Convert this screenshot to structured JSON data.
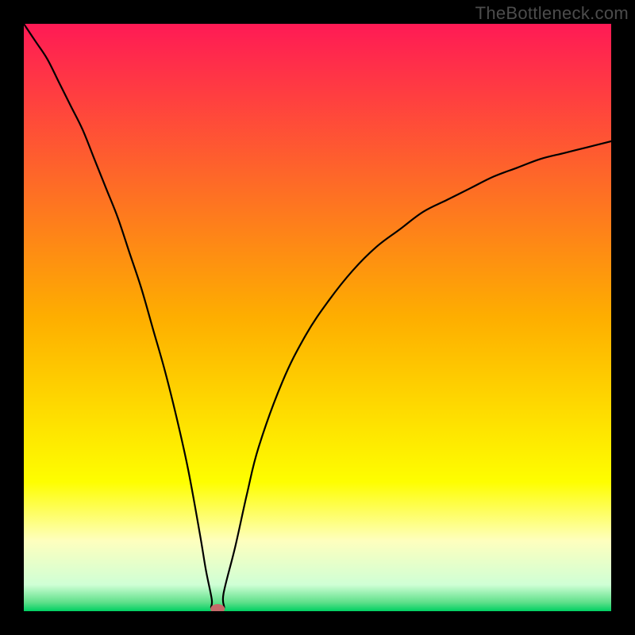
{
  "watermark": "TheBottleneck.com",
  "chart_data": {
    "type": "line",
    "title": "",
    "xlabel": "",
    "ylabel": "",
    "xlim": [
      0,
      100
    ],
    "ylim": [
      0,
      100
    ],
    "curve_min_x": 33,
    "marker": {
      "x": 33,
      "y": 0,
      "color": "#c56a6a"
    },
    "background_gradient": [
      {
        "offset": 0.0,
        "color": "#ff1a55"
      },
      {
        "offset": 0.5,
        "color": "#feae00"
      },
      {
        "offset": 0.78,
        "color": "#fefe00"
      },
      {
        "offset": 0.88,
        "color": "#feffbe"
      },
      {
        "offset": 0.955,
        "color": "#cfffd5"
      },
      {
        "offset": 0.985,
        "color": "#5fe08a"
      },
      {
        "offset": 1.0,
        "color": "#00d062"
      }
    ],
    "series": [
      {
        "name": "bottleneck-curve",
        "x": [
          0,
          2,
          4,
          6,
          8,
          10,
          12,
          14,
          16,
          18,
          20,
          22,
          24,
          26,
          28,
          30,
          31,
          32,
          33,
          34,
          36,
          38,
          40,
          44,
          48,
          52,
          56,
          60,
          64,
          68,
          72,
          76,
          80,
          84,
          88,
          92,
          96,
          100
        ],
        "y_left": [
          100,
          97,
          94,
          90,
          86,
          82,
          77,
          72,
          67,
          61,
          55,
          48,
          41,
          33,
          24,
          13,
          7,
          2,
          0
        ],
        "y_right": [
          0,
          3,
          11,
          20,
          28,
          39,
          47,
          53,
          58,
          62,
          65,
          68,
          70,
          72,
          74,
          75.5,
          77,
          78,
          79,
          80
        ]
      }
    ]
  }
}
